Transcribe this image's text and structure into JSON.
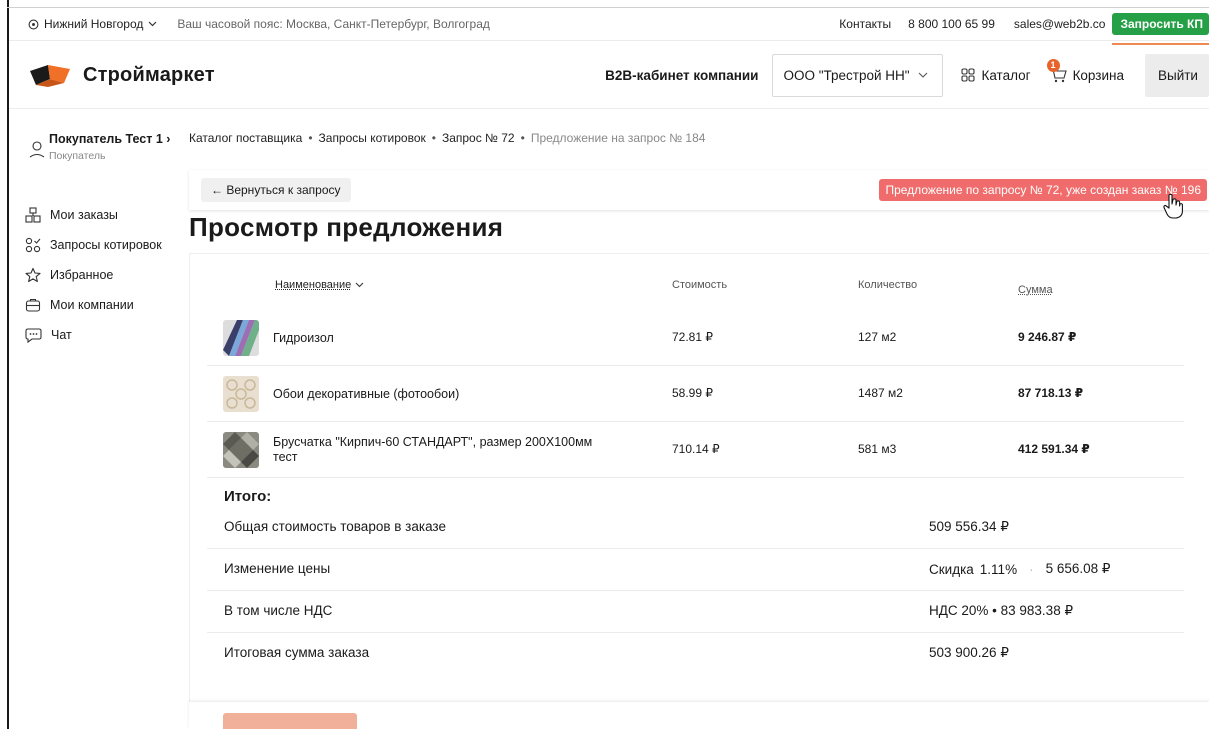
{
  "topbar": {
    "city": "Нижний Новгород",
    "timezone": "Ваш часовой пояс: Москва, Санкт-Петербург, Волгоград",
    "contacts": "Контакты",
    "phone": "8 800 100 65 99",
    "email": "sales@web2b.co",
    "request_kp": "Запросить КП"
  },
  "header": {
    "logo_text": "Строймаркет",
    "b2b_label": "B2B-кабинет компании",
    "company": "ООО \"Трестрой НН\"",
    "catalog": "Каталог",
    "cart": "Корзина",
    "cart_count": "1",
    "logout": "Выйти"
  },
  "user": {
    "name": "Покупатель Тест 1",
    "chevron": "›",
    "role": "Покупатель"
  },
  "sidebar": {
    "items": [
      {
        "label": "Мои заказы",
        "icon": "orders-icon"
      },
      {
        "label": "Запросы котировок",
        "icon": "quotes-icon"
      },
      {
        "label": "Избранное",
        "icon": "star-icon"
      },
      {
        "label": "Мои компании",
        "icon": "company-icon"
      },
      {
        "label": "Чат",
        "icon": "chat-icon"
      }
    ]
  },
  "breadcrumbs": [
    "Каталог поставщика",
    "Запросы котировок",
    "Запрос № 72",
    "Предложение на запрос № 184"
  ],
  "back_button": "← Вернуться к запросу",
  "notice": "Предложение по запросу № 72, уже создан заказ № 196",
  "page_title": "Просмотр предложения",
  "table": {
    "headers": {
      "name": "Наименование",
      "cost": "Стоимость",
      "qty": "Количество",
      "sum": "Сумма"
    },
    "rows": [
      {
        "name": "Гидроизол",
        "cost": "72.81 ₽",
        "qty": "127 м2",
        "sum": "9 246.87 ₽"
      },
      {
        "name": "Обои декоративные (фотообои)",
        "cost": "58.99 ₽",
        "qty": "1487 м2",
        "sum": "87 718.13 ₽"
      },
      {
        "name": "Брусчатка \"Кирпич-60 СТАНДАРТ\", размер 200Х100мм тест",
        "cost": "710.14 ₽",
        "qty": "581 м3",
        "sum": "412 591.34 ₽"
      }
    ]
  },
  "totals": {
    "title": "Итого:",
    "goods_label": "Общая стоимость товаров в заказе",
    "goods_value": "509 556.34 ₽",
    "price_change_label": "Изменение цены",
    "discount_label": "Скидка",
    "discount_percent": "1.11%",
    "discount_value": "5 656.08 ₽",
    "vat_label": "В том числе НДС",
    "vat_value": "НДС 20% • 83 983.38 ₽",
    "final_label": "Итоговая сумма заказа",
    "final_value": "503 900.26 ₽"
  }
}
